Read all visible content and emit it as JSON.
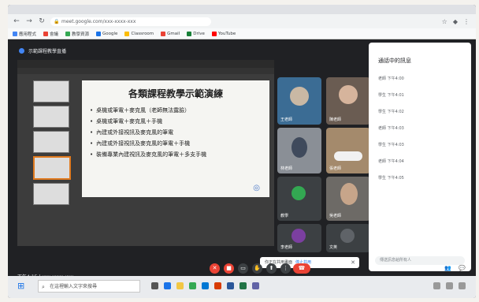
{
  "browser": {
    "url": "meet.google.com/xxx-xxxx-xxx",
    "bookmarks": [
      "應用程式",
      "會議",
      "教學資源",
      "Google",
      "Classroom",
      "Gmail",
      "Drive",
      "YouTube"
    ]
  },
  "meet": {
    "title": "示範課程教學直播"
  },
  "slide": {
    "title": "各類課程教學示範演練",
    "bullets": [
      "桌機或筆電＋麥克風（老師無法露臉）",
      "桌機或筆電＋麥克風＋手機",
      "內建或外接視訊及麥克風的筆電",
      "內建或外接視訊及麥克風的筆電＋手機",
      "裝備專業內建視訊及麥克風的筆電＋多支手機"
    ]
  },
  "participants": [
    {
      "name": "王老師",
      "avatar_color": "#1a73e8"
    },
    {
      "name": "陳老師",
      "avatar_color": "#c2185b"
    },
    {
      "name": "林老師"
    },
    {
      "name": "張老師"
    },
    {
      "name": "教學",
      "avatar_color": "#33a852"
    },
    {
      "name": "吳老師"
    },
    {
      "name": "李老師",
      "avatar_color": "#7b3fa0"
    },
    {
      "name": "文英",
      "avatar_color": "#5f6368"
    }
  ],
  "chat": {
    "title": "通話中的訊息",
    "messages": [
      {
        "who": "老師 下午4:00"
      },
      {
        "who": "學生 下午4:01"
      },
      {
        "who": "學生 下午4:02"
      },
      {
        "who": "老師 下午4:03"
      },
      {
        "who": "學生 下午4:03"
      },
      {
        "who": "老師 下午4:04"
      },
      {
        "who": "學生 下午4:05"
      }
    ],
    "input_placeholder": "傳送訊息給所有人"
  },
  "toast": {
    "text": "你正在共用畫面",
    "action": "停止共用"
  },
  "controls": {
    "time": "下午4:15 | xxx-xxxx-xxx"
  },
  "taskbar": {
    "search_placeholder": "在這裡輸入文字來搜尋"
  },
  "colors": {
    "end_call": "#ea4335",
    "accent": "#1a73e8"
  }
}
